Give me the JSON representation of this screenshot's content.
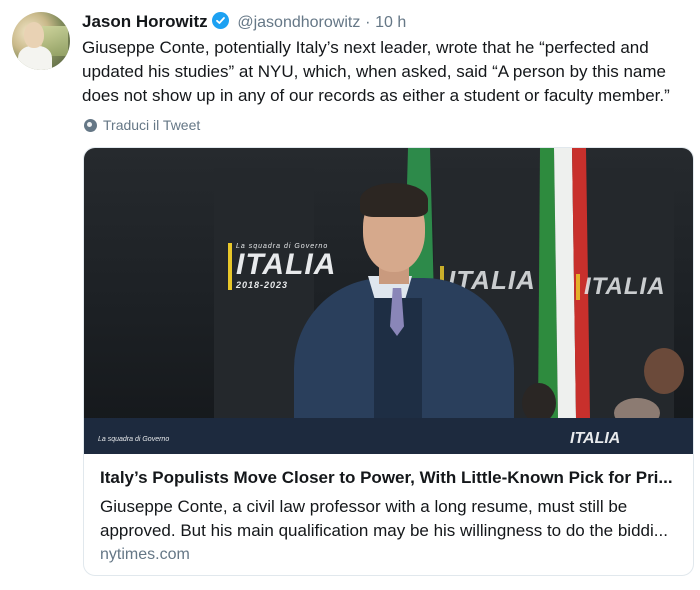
{
  "tweet": {
    "author_name": "Jason Horowitz",
    "verified_icon": "verified-badge-icon",
    "handle": "@jasondhorowitz",
    "separator": "·",
    "time": "10 h",
    "text": "Giuseppe Conte, potentially Italy’s next leader, wrote that he “perfected and updated his studies” at NYU, which, when asked, said “A person by this name does not show up in any of our records as either a student or faculty member.”",
    "translate_label": "Traduci il Tweet",
    "translate_icon": "globe-icon"
  },
  "card": {
    "image_signage": {
      "logo_small": "La squadra di Governo",
      "logo_word": "ITALIA",
      "logo_years": "2018-2023"
    },
    "title": "Italy’s Populists Move Closer to Power, With Little-Known Pick for Pri...",
    "description": "Giuseppe Conte, a civil law professor with a long resume, must still be approved. But his main qualification may be his willingness to do the biddi...",
    "domain": "nytimes.com"
  },
  "colors": {
    "text_primary": "#14171a",
    "text_secondary": "#657786",
    "verified_blue": "#1da1f2",
    "card_border": "#e1e8ed"
  }
}
